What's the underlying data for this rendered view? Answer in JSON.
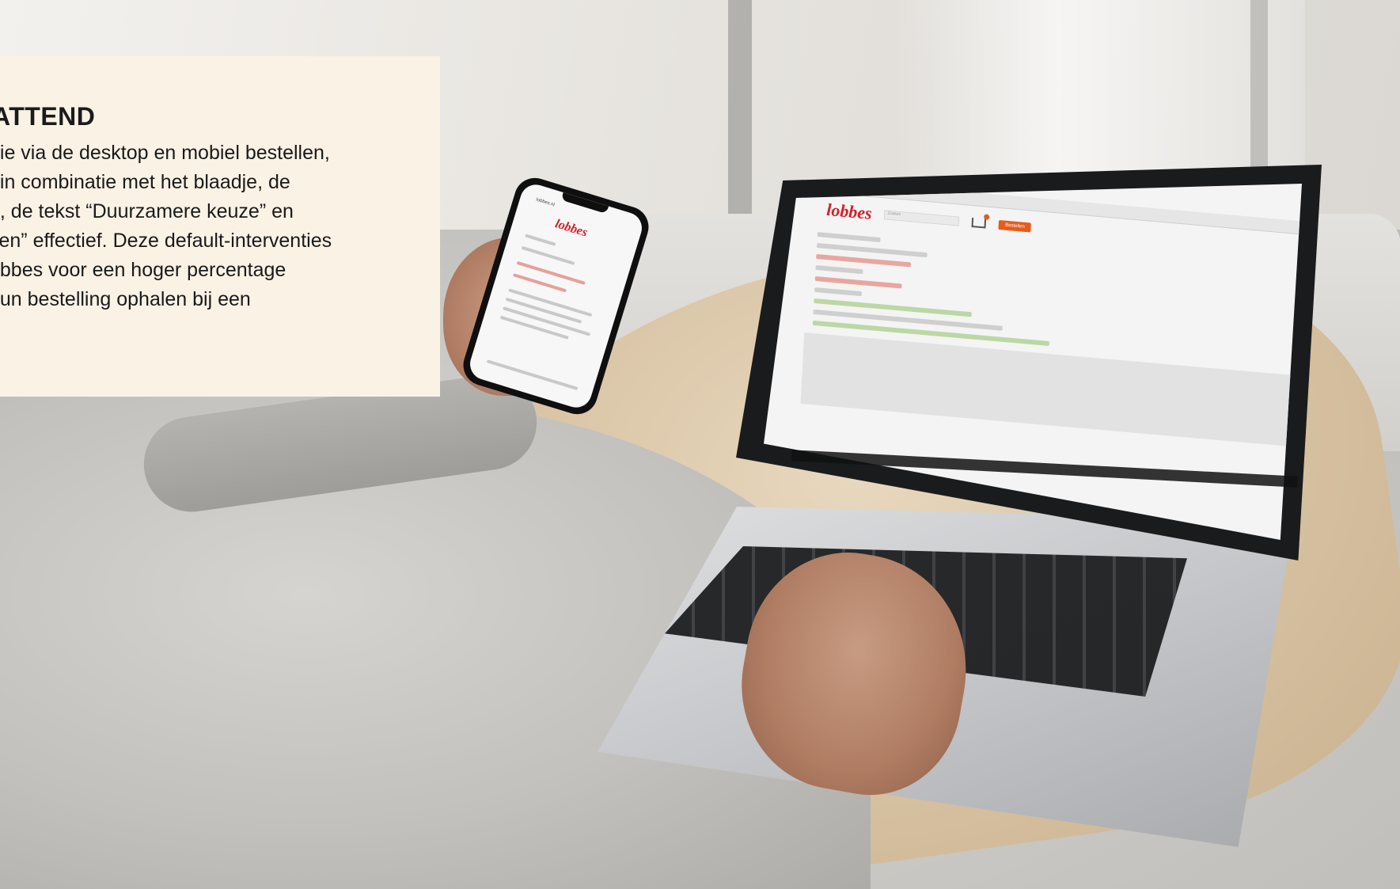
{
  "text_card": {
    "heading": "ATTEND",
    "lines": [
      "die via de desktop en mobiel bestellen,",
      "t in combinatie met het blaadje, de",
      "n, de tekst “Duurzamere keuze” en",
      "zen” effectief. Deze default-interventies",
      "obbes voor een hoger percentage",
      "hun bestelling ophalen bij een",
      "."
    ]
  },
  "laptop_screen": {
    "logo": "lobbes",
    "order_button": "Bestellen",
    "search_placeholder": "Zoeken"
  },
  "phone_screen": {
    "url": "lobbes.nl",
    "logo": "lobbes"
  },
  "colors": {
    "brand_red": "#d31f2a",
    "card_background": "#fbf2e6",
    "accent_orange": "#e35d1c"
  }
}
